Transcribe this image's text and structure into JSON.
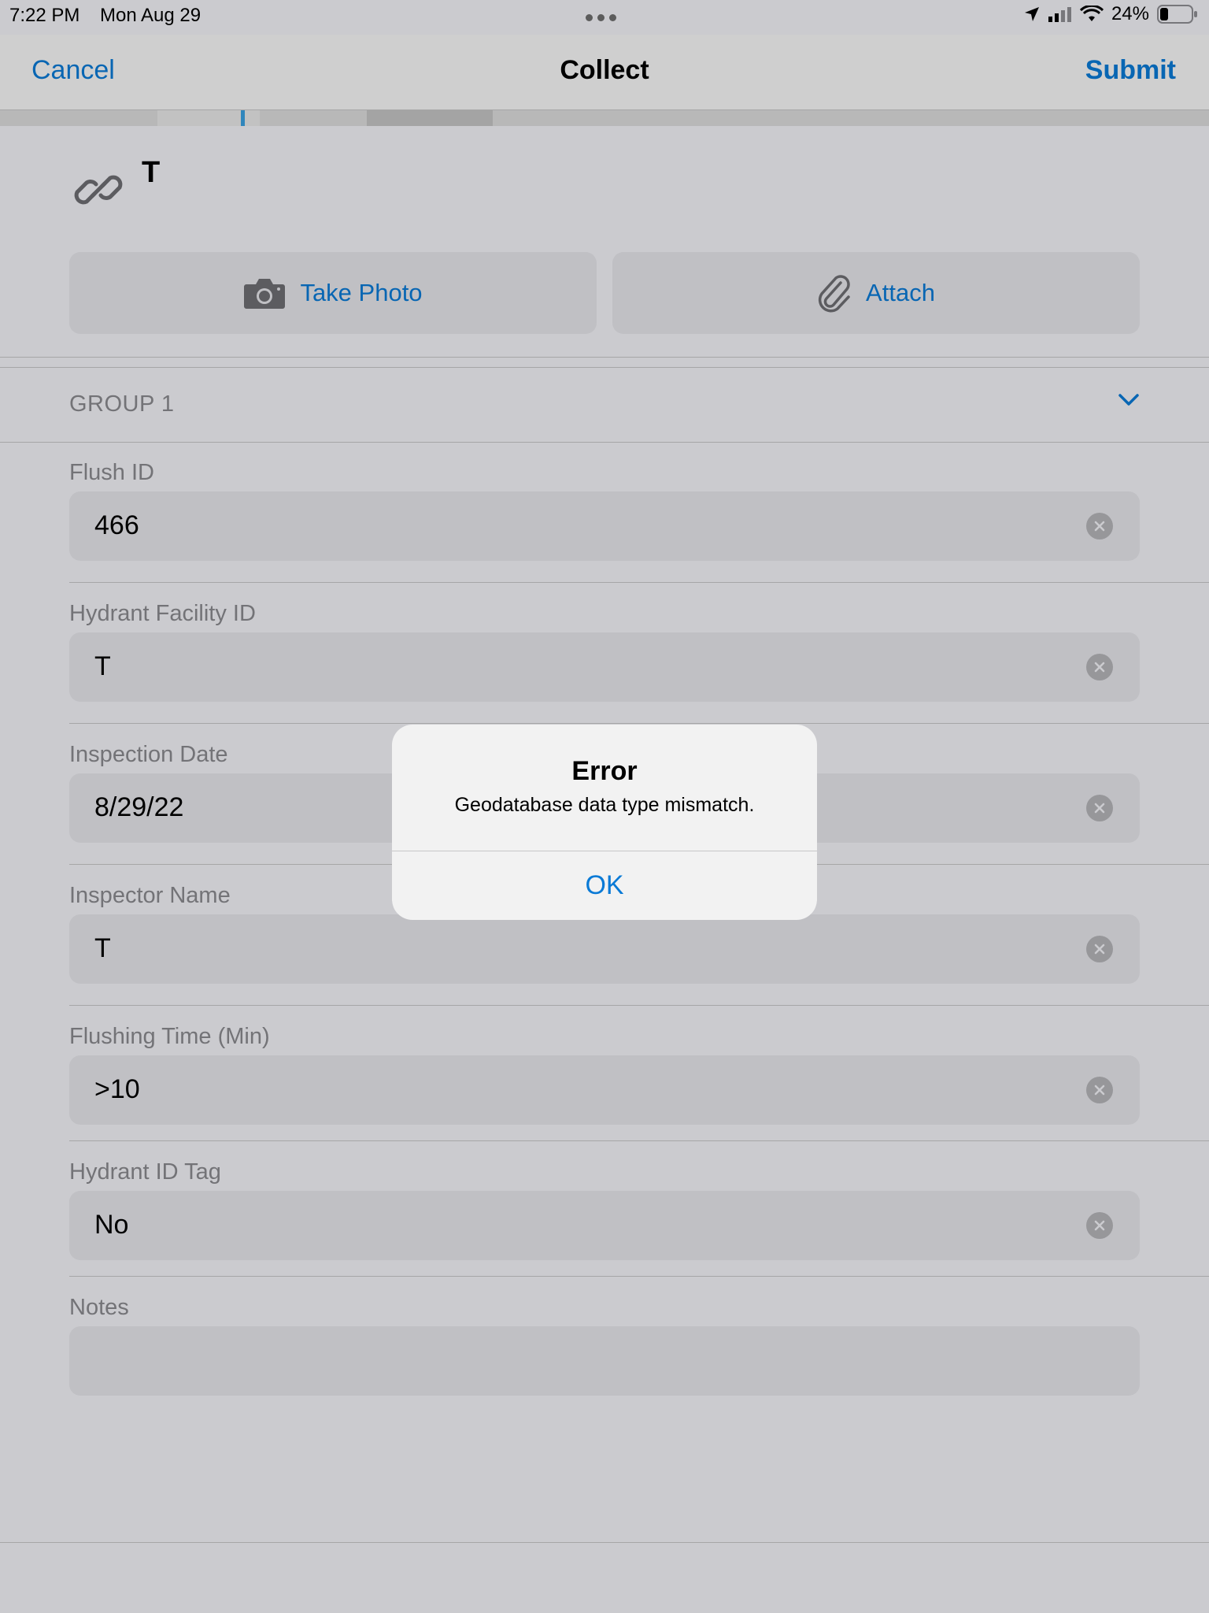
{
  "status_bar": {
    "time": "7:22 PM",
    "date": "Mon Aug 29",
    "battery": "24%"
  },
  "nav": {
    "cancel_label": "Cancel",
    "title": "Collect",
    "submit_label": "Submit"
  },
  "attachments": {
    "title": "T",
    "take_photo_label": "Take Photo",
    "attach_label": "Attach"
  },
  "group": {
    "title": "GROUP 1"
  },
  "fields": [
    {
      "label": "Flush ID",
      "value": "466"
    },
    {
      "label": "Hydrant Facility ID",
      "value": "T"
    },
    {
      "label": "Inspection Date",
      "value": "8/29/22"
    },
    {
      "label": "Inspector Name",
      "value": "T"
    },
    {
      "label": "Flushing Time (Min)",
      "value": ">10"
    },
    {
      "label": "Hydrant ID Tag",
      "value": "No"
    },
    {
      "label": "Notes",
      "value": ""
    }
  ],
  "alert": {
    "title": "Error",
    "message": "Geodatabase data type mismatch.",
    "ok_label": "OK"
  },
  "colors": {
    "accent": "#0a7ad6",
    "background": "#f2f2f7",
    "field_bg": "#e5e5ea"
  }
}
